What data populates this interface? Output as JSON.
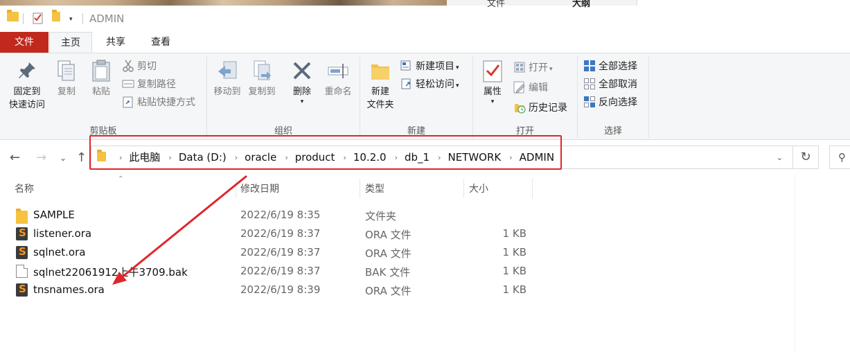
{
  "window": {
    "title": "ADMIN",
    "bg_tab1": "文件",
    "bg_tab2": "大纲"
  },
  "ribbon_tabs": {
    "file": "文件",
    "home": "主页",
    "share": "共享",
    "view": "查看"
  },
  "clipboard": {
    "pin_line1": "固定到",
    "pin_line2": "快速访问",
    "copy": "复制",
    "paste": "粘贴",
    "cut": "剪切",
    "copy_path": "复制路径",
    "paste_shortcut": "粘贴快捷方式",
    "label": "剪贴板"
  },
  "organize": {
    "move_to": "移动到",
    "copy_to": "复制到",
    "delete": "删除",
    "rename": "重命名",
    "label": "组织"
  },
  "new": {
    "folder_line1": "新建",
    "folder_line2": "文件夹",
    "new_item": "新建项目",
    "easy_access": "轻松访问",
    "label": "新建"
  },
  "open": {
    "properties": "属性",
    "open": "打开",
    "edit": "编辑",
    "history": "历史记录",
    "label": "打开"
  },
  "select": {
    "select_all": "全部选择",
    "select_none": "全部取消",
    "invert": "反向选择",
    "label": "选择"
  },
  "breadcrumbs": [
    "此电脑",
    "Data (D:)",
    "oracle",
    "product",
    "10.2.0",
    "db_1",
    "NETWORK",
    "ADMIN"
  ],
  "columns": {
    "name": "名称",
    "modified": "修改日期",
    "type": "类型",
    "size": "大小"
  },
  "files": [
    {
      "icon": "folder-icon",
      "name": "SAMPLE",
      "modified": "2022/6/19 8:35",
      "type": "文件夹",
      "size": ""
    },
    {
      "icon": "sublime-file-icon",
      "name": "listener.ora",
      "modified": "2022/6/19 8:37",
      "type": "ORA 文件",
      "size": "1 KB"
    },
    {
      "icon": "sublime-file-icon",
      "name": "sqlnet.ora",
      "modified": "2022/6/19 8:37",
      "type": "ORA 文件",
      "size": "1 KB"
    },
    {
      "icon": "document-icon",
      "name": "sqlnet22061912上午3709.bak",
      "modified": "2022/6/19 8:37",
      "type": "BAK 文件",
      "size": "1 KB"
    },
    {
      "icon": "sublime-file-icon",
      "name": "tnsnames.ora",
      "modified": "2022/6/19 8:39",
      "type": "ORA 文件",
      "size": "1 KB"
    }
  ],
  "colors": {
    "file_tab": "#c1291c",
    "annotation": "#e0262a",
    "folder": "#f5c242",
    "sublime": "#f89620"
  }
}
